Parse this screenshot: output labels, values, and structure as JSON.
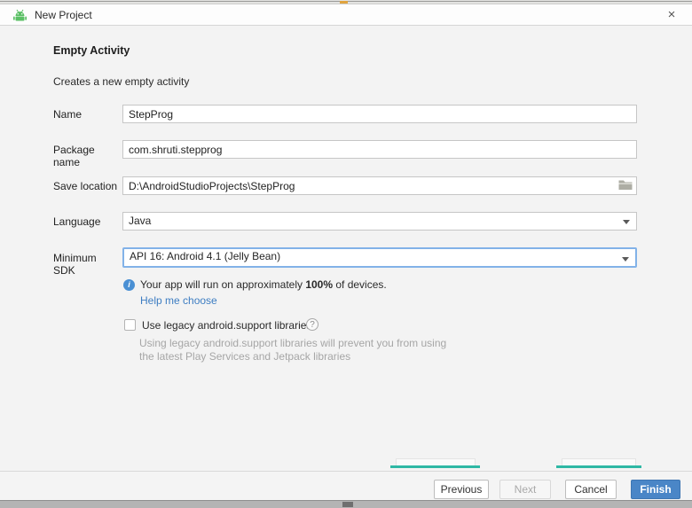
{
  "window": {
    "title": "New Project"
  },
  "icons": {
    "close": "×",
    "info": "i",
    "help": "?"
  },
  "header": {
    "title": "Empty Activity",
    "subtitle": "Creates a new empty activity"
  },
  "form": {
    "name": {
      "label": "Name",
      "value": "StepProg"
    },
    "package": {
      "label": "Package name",
      "value": "com.shruti.stepprog"
    },
    "save_location": {
      "label": "Save location",
      "value": "D:\\AndroidStudioProjects\\StepProg"
    },
    "language": {
      "label": "Language",
      "value": "Java"
    },
    "min_sdk": {
      "label": "Minimum SDK",
      "value": "API 16: Android 4.1 (Jelly Bean)"
    }
  },
  "info": {
    "text_before": "Your app will run on approximately ",
    "percent": "100%",
    "text_after": " of devices.",
    "link": "Help me choose"
  },
  "legacy": {
    "label": "Use legacy android.support libraries",
    "checked": false,
    "help_line1": "Using legacy android.support libraries will prevent you from using",
    "help_line2": "the latest Play Services and Jetpack libraries"
  },
  "footer": {
    "previous": "Previous",
    "next": "Next",
    "cancel": "Cancel",
    "finish": "Finish"
  },
  "colors": {
    "accent_blue": "#4a86c7",
    "focus_border": "#82b2e8",
    "link_blue": "#3d7dc2",
    "info_blue": "#4a90d4",
    "teal_artifact": "#2fb8a5",
    "android_green": "#5bc065"
  }
}
